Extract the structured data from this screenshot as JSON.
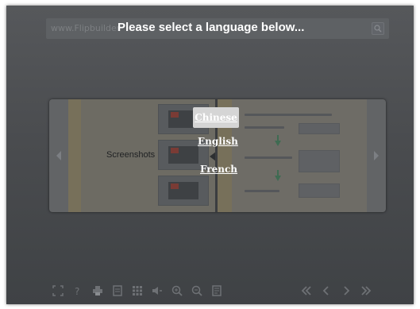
{
  "header": {
    "site_text": "www.Flipbuilder",
    "prompt": "Please select a language below..."
  },
  "book": {
    "left_page_label": "Screenshots",
    "right_page_title": "How to create flipbook with PPT files",
    "steps": [
      "Step 1: Import PPT files",
      "Step 2: Template Config",
      "Step 3: Convert"
    ]
  },
  "languages": [
    {
      "label": "Chinese",
      "selected": true
    },
    {
      "label": "English",
      "selected": false
    },
    {
      "label": "French",
      "selected": false
    }
  ],
  "icons": {
    "toolbar_left": [
      "fullscreen-icon",
      "help-icon",
      "print-icon",
      "download-icon",
      "thumbnails-icon",
      "sound-icon",
      "zoom-in-icon",
      "zoom-out-icon",
      "bookmark-icon"
    ],
    "toolbar_right": [
      "first-page-icon",
      "previous-page-icon",
      "next-page-icon",
      "last-page-icon"
    ]
  },
  "colors": {
    "frame": "#4a4c4f",
    "highlight": "#d5d5d5",
    "text": "#ffffff"
  }
}
